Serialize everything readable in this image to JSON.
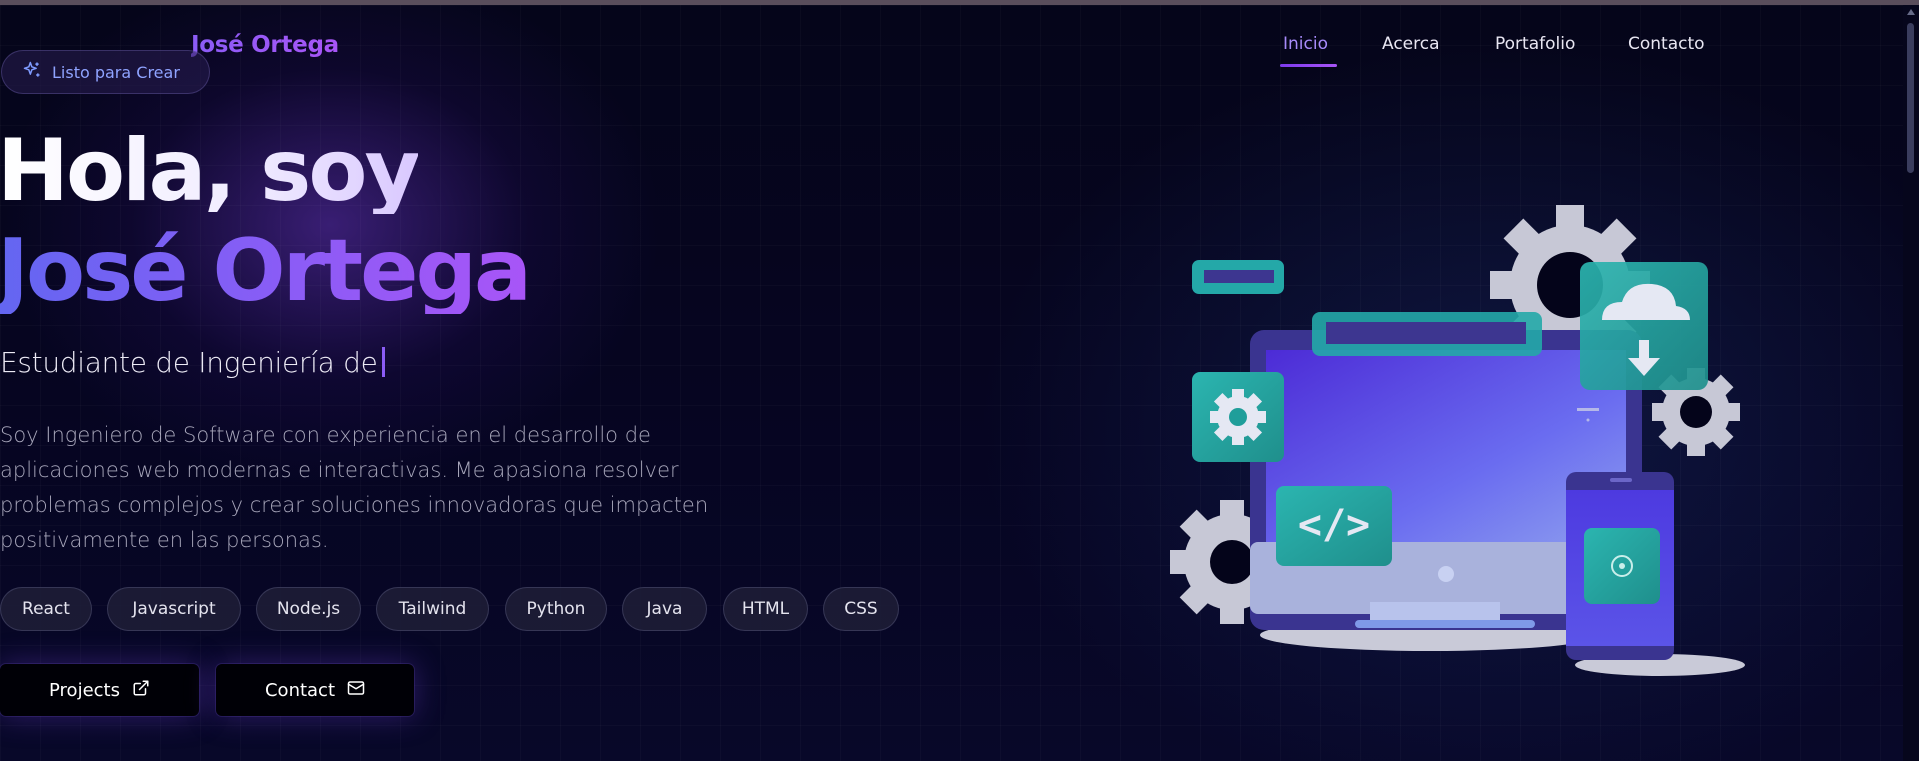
{
  "header": {
    "brand": "José Ortega",
    "nav": [
      {
        "label": "Inicio",
        "active": true
      },
      {
        "label": "Acerca",
        "active": false
      },
      {
        "label": "Portafolio",
        "active": false
      },
      {
        "label": "Contacto",
        "active": false
      }
    ]
  },
  "hero": {
    "badge": "Listo para Crear",
    "greeting": "Hola, soy",
    "name": "José Ortega",
    "subtitle": "Estudiante de Ingeniería de",
    "description": "Soy Ingeniero de Software con experiencia en el desarrollo de aplicaciones web modernas e interactivas. Me apasiona resolver problemas complejos y crear soluciones innovadoras que impacten positivamente en las personas.",
    "skills": [
      "React",
      "Javascript",
      "Node.js",
      "Tailwind",
      "Python",
      "Java",
      "HTML",
      "CSS"
    ],
    "buttons": {
      "projects": "Projects",
      "contact": "Contact"
    }
  },
  "colors": {
    "accent": "#8b5cf6",
    "accent_blue": "#6366f1",
    "background": "#04041a",
    "teal": "#22b8a8"
  },
  "icons": {
    "badge_icon": "sparkles-icon",
    "projects_icon": "external-link-icon",
    "contact_icon": "mail-icon"
  }
}
